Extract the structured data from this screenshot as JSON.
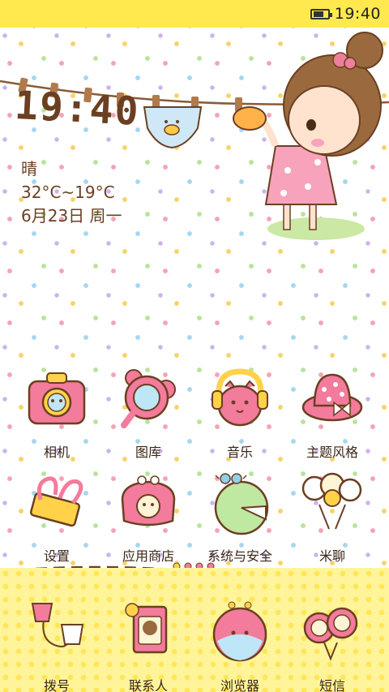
{
  "status_bar": {
    "time": "19:40",
    "battery_icon": "battery-icon"
  },
  "widget": {
    "clock": "19:40",
    "weather": "晴",
    "temperature": "32°C~19°C",
    "date": "6月23日 周一"
  },
  "apps": [
    {
      "label": "相机",
      "icon": "camera-icon"
    },
    {
      "label": "图库",
      "icon": "gallery-icon"
    },
    {
      "label": "音乐",
      "icon": "music-icon"
    },
    {
      "label": "主题风格",
      "icon": "theme-icon"
    },
    {
      "label": "设置",
      "icon": "settings-icon"
    },
    {
      "label": "应用商店",
      "icon": "app-store-icon"
    },
    {
      "label": "系统与安全",
      "icon": "security-icon"
    },
    {
      "label": "米聊",
      "icon": "miliao-icon"
    }
  ],
  "dock": [
    {
      "label": "拨号",
      "icon": "phone-icon"
    },
    {
      "label": "联系人",
      "icon": "contacts-icon"
    },
    {
      "label": "浏览器",
      "icon": "browser-icon"
    },
    {
      "label": "短信",
      "icon": "messages-icon"
    }
  ],
  "colors": {
    "status_bar": "#ffe94f",
    "dock": "#fff49a",
    "text_brown": "#6b3f22",
    "pink": "#ee7f9c"
  }
}
